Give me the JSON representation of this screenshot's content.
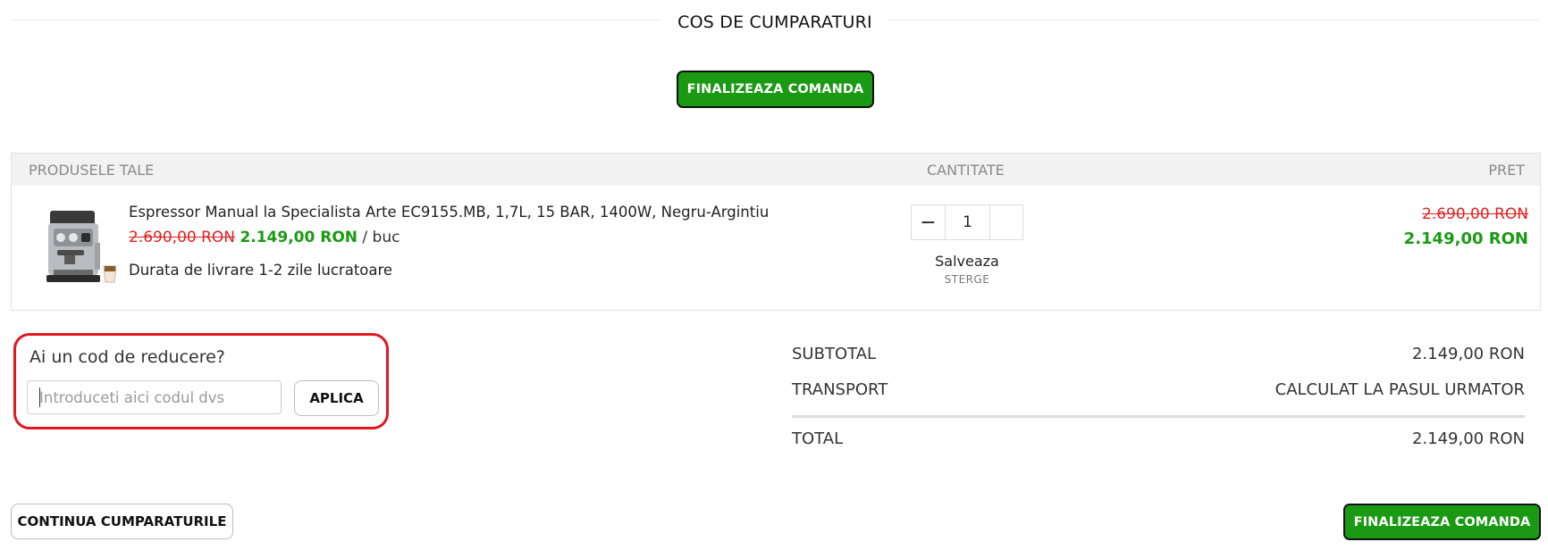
{
  "page": {
    "title": "COS DE CUMPARATURI"
  },
  "actions": {
    "checkout_label": "FINALIZEAZA COMANDA",
    "continue_label": "CONTINUA CUMPARATURILE"
  },
  "table": {
    "headers": {
      "products": "PRODUSELE TALE",
      "quantity": "CANTITATE",
      "price": "PRET"
    }
  },
  "item": {
    "name": "Espressor Manual la Specialista Arte EC9155.MB, 1,7L, 15 BAR, 1400W, Negru-Argintiu",
    "old_price": "2.690,00 RON",
    "new_price": "2.149,00 RON",
    "unit": "/ buc",
    "delivery": "Durata de livrare 1-2 zile lucratoare",
    "quantity": "1",
    "save_label": "Salveaza",
    "delete_label": "STERGE",
    "image_icon": "espresso-machine-image"
  },
  "discount": {
    "title": "Ai un cod de reducere?",
    "placeholder": "Introduceti aici codul dvs",
    "apply_label": "APLICA"
  },
  "totals": {
    "subtotal_label": "SUBTOTAL",
    "subtotal_value": "2.149,00 RON",
    "shipping_label": "TRANSPORT",
    "shipping_value": "CALCULAT LA PASUL URMATOR",
    "total_label": "TOTAL",
    "total_value": "2.149,00 RON"
  },
  "colors": {
    "accent_green": "#1a9a13",
    "old_price_red": "#e02020",
    "highlight_red": "#e0181f"
  }
}
